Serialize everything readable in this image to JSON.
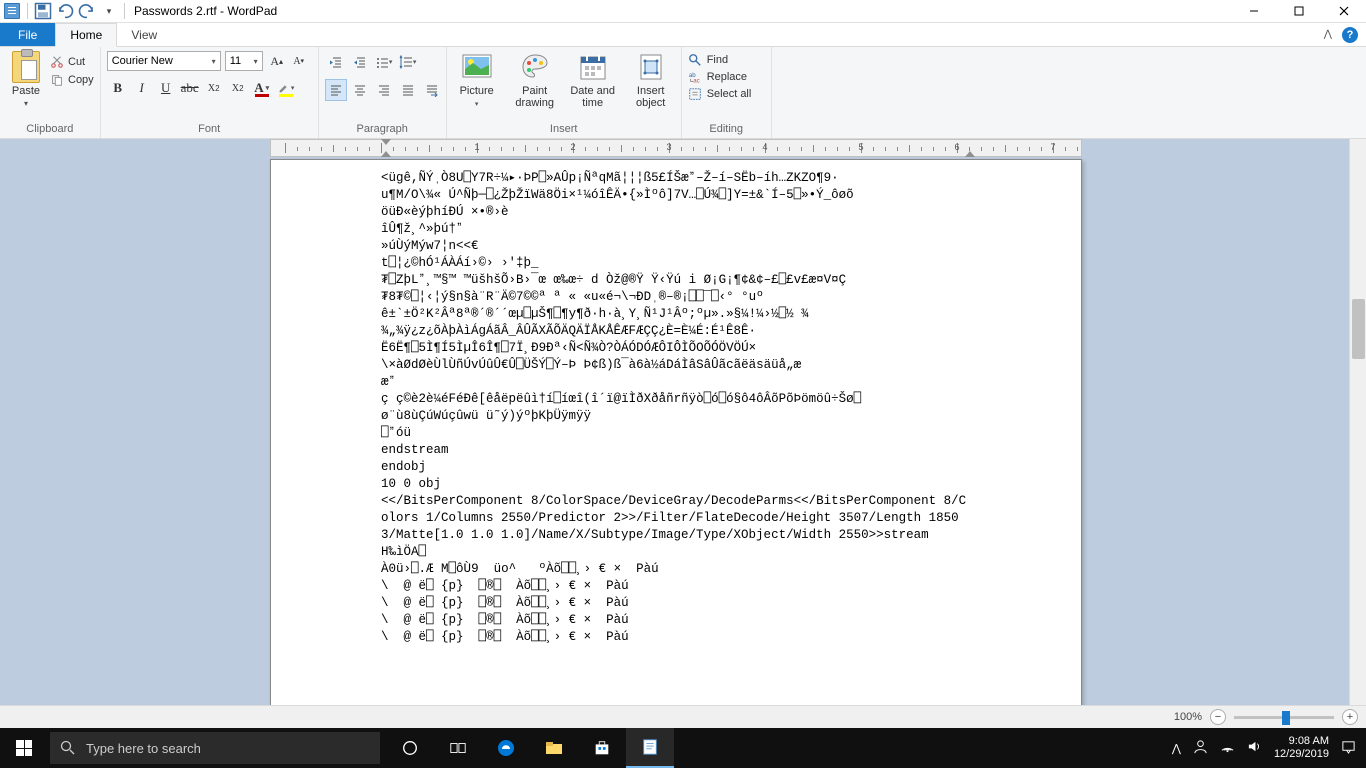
{
  "titlebar": {
    "title": "Passwords 2.rtf - WordPad"
  },
  "tabs": {
    "file": "File",
    "home": "Home",
    "view": "View"
  },
  "ribbon": {
    "clipboard": {
      "label": "Clipboard",
      "paste": "Paste",
      "cut": "Cut",
      "copy": "Copy"
    },
    "font": {
      "label": "Font",
      "name": "Courier New",
      "size": "11"
    },
    "paragraph": {
      "label": "Paragraph"
    },
    "insert": {
      "label": "Insert",
      "picture": "Picture",
      "paint": "Paint drawing",
      "datetime": "Date and time",
      "object": "Insert object"
    },
    "editing": {
      "label": "Editing",
      "find": "Find",
      "replace": "Replace",
      "selectall": "Select all"
    }
  },
  "ruler": {
    "marks": [
      "1",
      "2",
      "3",
      "4",
      "5",
      "6",
      "7"
    ]
  },
  "document": {
    "text": "<ügê,ÑÝˌÒ8U⎕Y7R÷¼▸·ÞP⎕»AÛp¡ÑªqMã¦¦¦ß5£ÍŠæˮ–Ž–í–SËb–íh…ZKZO¶9·\nu¶M/O\\¾« Ú^Ñþ─⎕¿ŽþŽïWä8Öi×¹¼óîÊÄ•{»Ìºô]7V…⎕Ú¾⎕]Y=±&`Í–5⎕»•Ý_ôøõ\nöüÐ«èýþhíÐÚ ×•®›è\nîÛ¶ž¸^»þú†ˮ\n»úÙýMýw7¦n<<€\nt⎕¦¿©hÓ¹ÁÀÁí›©› ›'‡þ_\n₮⎕ZþLˮ¸™§™ ™üšhšÕ›B›¯œ œ‰œ÷ d Òž@®Ÿ Ÿ‹Ÿú i Ø¡G¡¶¢&¢–£⎕£v£æ¤V¤Ç\n₮8₮©⎕¦‹¦ý§n§à¨R¨Ä©7©©ª ª « «u«é¬\\¬ÐDˌ®–®¡⎕⎕‾⎕‹° °uº\nê±`±Ö²K²Âª8ª®´®´´œµ⎕µŠ¶⎕¶y¶ð·h·à¸Y¸Ñ¹J¹Âº;ºµ».»§¼!¼›½⎕½ ¾\n¾„¾ÿ¿z¿õÀþÀìÁgÁãÂ_ÂÛÃXÃÕÄQÄÏÅKÅÊÆFÆÇÇ¿È=È¼É:É¹Ê8Ê·\nË6Ë¶⎕5Ì¶Í5ÌµÎ6Î¶⎕7Ï¸Ð9Ðª‹Ñ<Ñ¾Ò?ÒÁÓDÓÆÔIÔÌÕOÕÓÖVÖÚ×\n\\×àØdØèÙlÙñÚvÚûÛ€Û⎕ÜŠÝ⎕Ý–Þ Þ¢ß)ß¯à6à½áDáÌâSâÛãcãëäsäüå„æ\næˮ\nç ç©è2è¼éFéÐê[êåëpëûì†í⎕íœî(î´ï@ïÌðXðåñrñÿò⎕ó⎕ó§ô4ôÂõPõÞömöû÷Šø⎕\nø¨ù8ùÇúWúçûwü ü˜ý)ýºþKþÜÿmÿÿ\n⎕ˮóü\nendstream\nendobj\n10 0 obj\n<</BitsPerComponent 8/ColorSpace/DeviceGray/DecodeParms<</BitsPerComponent 8/Colors 1/Columns 2550/Predictor 2>>/Filter/FlateDecode/Height 3507/Length 18503/Matte[1.0 1.0 1.0]/Name/X/Subtype/Image/Type/XObject/Width 2550>>stream\nH‰ìÖA⎕\nÀ0ü›⎕.Æ M⎕ôÙ9  üo^   ºÀõ⎕⎕¸› € ×  Pàú\n\\  @ ë⎕ {p}  ⎕®⎕  Àõ⎕⎕¸› € ×  Pàú\n\\  @ ë⎕ {p}  ⎕®⎕  Àõ⎕⎕¸› € ×  Pàú\n\\  @ ë⎕ {p}  ⎕®⎕  Àõ⎕⎕¸› € ×  Pàú\n\\  @ ë⎕ {p}  ⎕®⎕  Àõ⎕⎕¸› € ×  Pàú"
  },
  "statusbar": {
    "zoom": "100%"
  },
  "taskbar": {
    "search_placeholder": "Type here to search",
    "time": "9:08 AM",
    "date": "12/29/2019"
  }
}
